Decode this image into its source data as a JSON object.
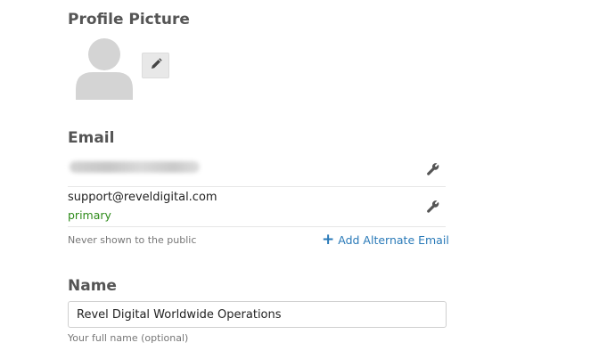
{
  "profile": {
    "title": "Profile Picture",
    "avatar_icon": "user-silhouette-icon",
    "edit_icon": "pencil-icon"
  },
  "email": {
    "title": "Email",
    "rows": [
      {
        "address": "",
        "tag": "",
        "blurred": true,
        "action_icon": "wrench-icon"
      },
      {
        "address": "support@reveldigital.com",
        "tag": "primary",
        "blurred": false,
        "action_icon": "wrench-icon"
      }
    ],
    "hint": "Never shown to the public",
    "add_label": "Add Alternate Email",
    "add_icon": "plus-icon"
  },
  "name": {
    "title": "Name",
    "value": "Revel Digital Worldwide Operations",
    "hint": "Your full name (optional)"
  },
  "colors": {
    "heading": "#555555",
    "link": "#2a7ab8",
    "primary_tag": "#2e8b1a",
    "avatar": "#d4d4d4"
  }
}
